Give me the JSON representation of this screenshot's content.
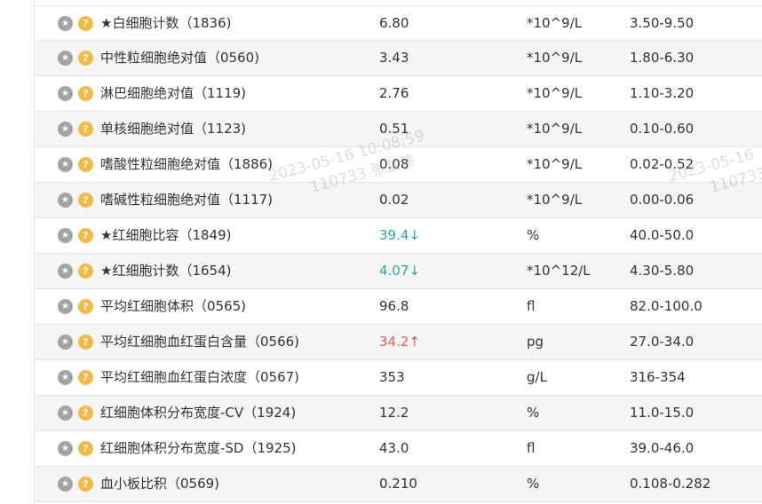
{
  "icons": {
    "star_icon": "★",
    "help_icon": "?"
  },
  "rows": [
    {
      "name": "★白细胞计数（1836)",
      "value": "6.80",
      "flag": "",
      "unit": "*10^9/L",
      "range": "3.50-9.50"
    },
    {
      "name": "中性粒细胞绝对值（0560)",
      "value": "3.43",
      "flag": "",
      "unit": "*10^9/L",
      "range": "1.80-6.30"
    },
    {
      "name": "淋巴细胞绝对值（1119)",
      "value": "2.76",
      "flag": "",
      "unit": "*10^9/L",
      "range": "1.10-3.20"
    },
    {
      "name": "单核细胞绝对值（1123)",
      "value": "0.51",
      "flag": "",
      "unit": "*10^9/L",
      "range": "0.10-0.60"
    },
    {
      "name": "嗜酸性粒细胞绝对值（1886)",
      "value": "0.08",
      "flag": "",
      "unit": "*10^9/L",
      "range": "0.02-0.52"
    },
    {
      "name": "嗜碱性粒细胞绝对值（1117)",
      "value": "0.02",
      "flag": "",
      "unit": "*10^9/L",
      "range": "0.00-0.06"
    },
    {
      "name": "★红细胞比容（1849)",
      "value": "39.4",
      "flag": "↓",
      "unit": "%",
      "range": "40.0-50.0"
    },
    {
      "name": "★红细胞计数（1654)",
      "value": "4.07",
      "flag": "↓",
      "unit": "*10^12/L",
      "range": "4.30-5.80"
    },
    {
      "name": "平均红细胞体积（0565)",
      "value": "96.8",
      "flag": "",
      "unit": "fl",
      "range": "82.0-100.0"
    },
    {
      "name": "平均红细胞血红蛋白含量（0566)",
      "value": "34.2",
      "flag": "↑",
      "unit": "pg",
      "range": "27.0-34.0"
    },
    {
      "name": "平均红细胞血红蛋白浓度（0567)",
      "value": "353",
      "flag": "",
      "unit": "g/L",
      "range": "316-354"
    },
    {
      "name": "红细胞体积分布宽度-CV（1924)",
      "value": "12.2",
      "flag": "",
      "unit": "%",
      "range": "11.0-15.0"
    },
    {
      "name": "红细胞体积分布宽度-SD（1925)",
      "value": "43.0",
      "flag": "",
      "unit": "fl",
      "range": "39.0-46.0"
    },
    {
      "name": "血小板比积（0569)",
      "value": "0.210",
      "flag": "",
      "unit": "%",
      "range": "0.108-0.282"
    }
  ],
  "watermarks": [
    {
      "line1": "2023-05-16 10:08:59",
      "line2": "110733 张益伟"
    },
    {
      "line1": "2023-05-16",
      "line2": "110733"
    }
  ],
  "colors": {
    "low": "#2ba3a3",
    "high": "#e85b50"
  }
}
